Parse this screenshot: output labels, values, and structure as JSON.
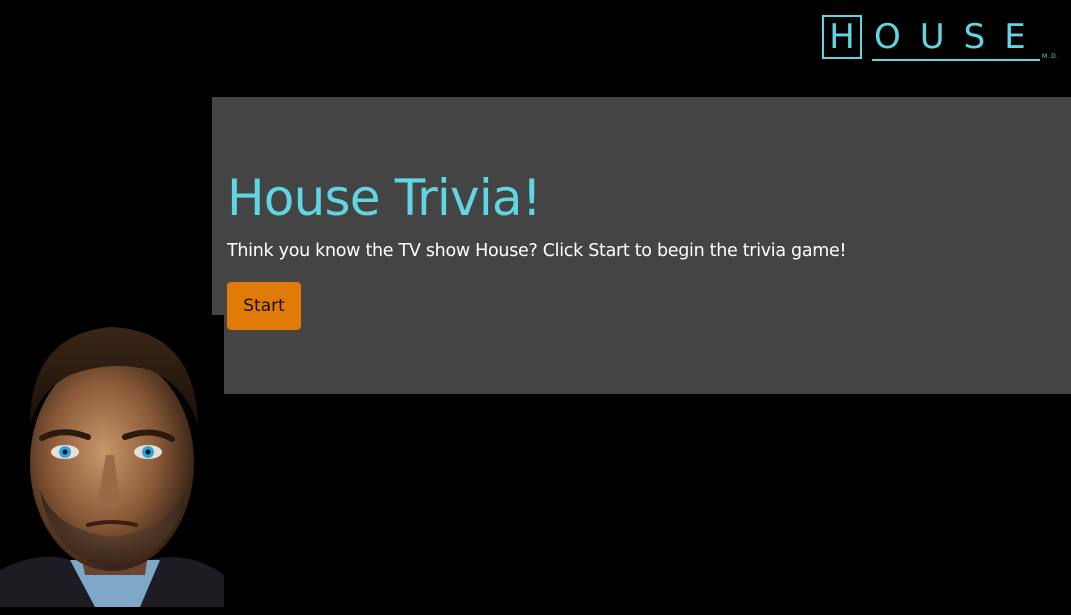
{
  "logo": {
    "first_letter": "H",
    "rest": "OUSE",
    "suffix": "M.D."
  },
  "main": {
    "title": "House Trivia!",
    "description": "Think you know the TV show House? Click Start to begin the trivia game!",
    "start_label": "Start"
  },
  "colors": {
    "background": "#000000",
    "panel": "#444444",
    "accent": "#5fd6e2",
    "button": "#e07b09"
  },
  "images": {
    "portrait": "man-portrait"
  }
}
